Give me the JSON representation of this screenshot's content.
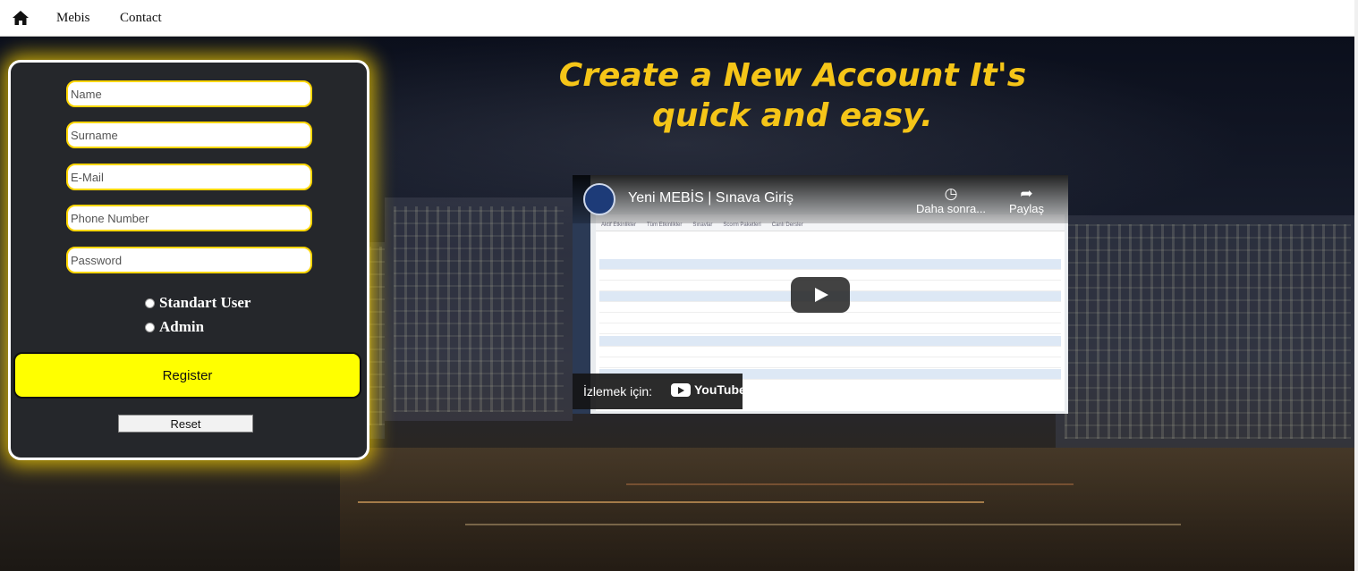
{
  "nav": {
    "home_icon": "home-icon",
    "links": [
      "Mebis",
      "Contact"
    ]
  },
  "form": {
    "fields": {
      "name_placeholder": "Name",
      "surname_placeholder": "Surname",
      "email_placeholder": "E-Mail",
      "phone_placeholder": "Phone Number",
      "password_placeholder": "Password"
    },
    "roles": [
      "Standart User",
      "Admin"
    ],
    "register_label": "Register",
    "reset_label": "Reset",
    "accent_color": "#ffff00",
    "glow_color": "#ffd700"
  },
  "headline": {
    "line1": "Create a New Account It's",
    "line2": "quick and easy."
  },
  "video": {
    "title": "Yeni MEBİS | Sınava Giriş",
    "later_label": "Daha sonra...",
    "share_label": "Paylaş",
    "watch_on_label": "İzlemek için:",
    "youtube_label": "YouTube"
  }
}
